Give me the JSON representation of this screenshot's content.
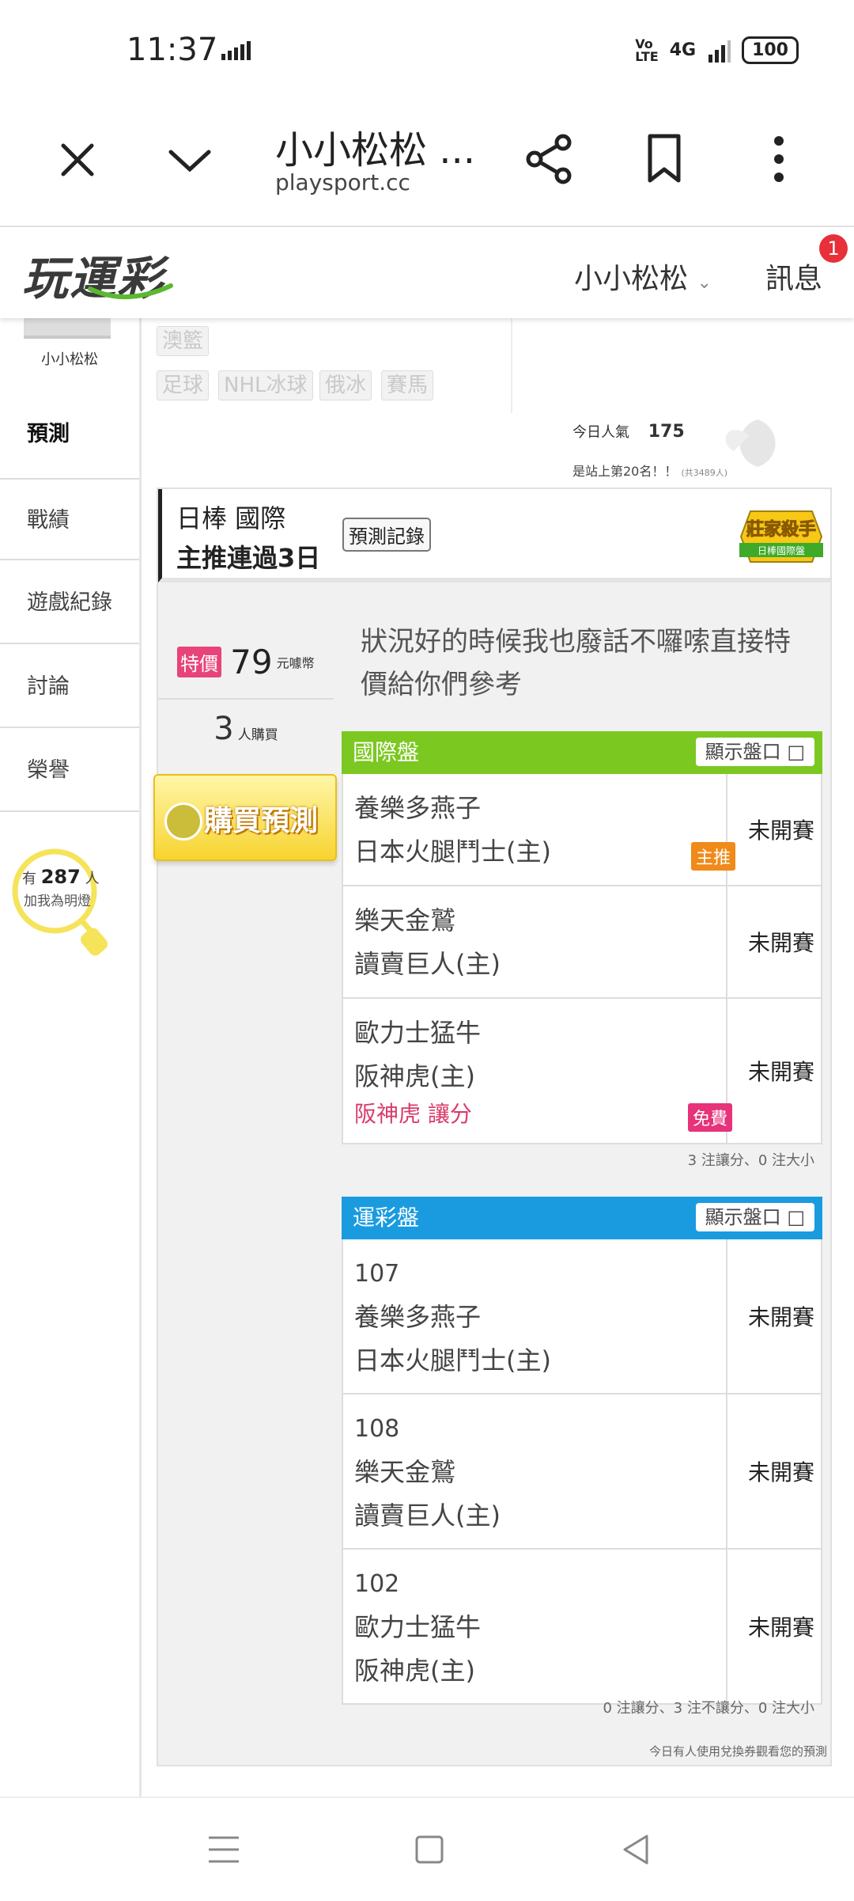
{
  "status_bar": {
    "time": "11:37",
    "network": "4G",
    "volte": "Vo\nLTE",
    "battery": "100"
  },
  "browser": {
    "title": "小小松松 ...",
    "url": "playsport.cc"
  },
  "site": {
    "logo": "玩運彩",
    "user_menu": "小小松松",
    "messages": "訊息",
    "message_badge": "1"
  },
  "sidebar": {
    "username": "小小松松",
    "items": [
      "預測",
      "戰績",
      "遊戲紀錄",
      "討論",
      "榮譽"
    ],
    "fans_prefix": "有",
    "fans_count": "287",
    "fans_suffix": "人",
    "fans_action": "加我為明燈"
  },
  "tags": [
    "澳籃",
    "足球",
    "NHL冰球",
    "俄冰",
    "賽馬"
  ],
  "stats": {
    "popularity_label": "今日人氣",
    "popularity_value": "175",
    "rank_text": "是站上第20名！！",
    "rank_total": "(共3489人)"
  },
  "prediction": {
    "league_line": "日棒 國際",
    "streak_line": "主推連過3日",
    "record_button": "預測記錄",
    "badge_title": "莊家殺手",
    "badge_sub": "日棒國際盤",
    "special_label": "特價",
    "price": "79",
    "price_unit": "元噱幣",
    "buyers_count": "3",
    "buyers_unit": "人購買",
    "buy_button": "購買預測",
    "comment": "狀況好的時候我也廢話不囉嗦直接特價給你們參考"
  },
  "intl_table": {
    "title": "國際盤",
    "show_button": "顯示盤口",
    "color": "#7bc820",
    "rows": [
      {
        "away": "養樂多燕子",
        "home": "日本火腿鬥士(主)",
        "status": "未開賽",
        "mark": "主推"
      },
      {
        "away": "樂天金鷲",
        "home": "讀賣巨人(主)",
        "status": "未開賽"
      },
      {
        "away": "歐力士猛牛",
        "home": "阪神虎(主)",
        "status": "未開賽",
        "pick": "阪神虎 讓分",
        "mark": "免費"
      }
    ],
    "summary": "3 注讓分、0 注大小"
  },
  "lottery_table": {
    "title": "運彩盤",
    "show_button": "顯示盤口",
    "color": "#1a9be0",
    "rows": [
      {
        "num": "107",
        "away": "養樂多燕子",
        "home": "日本火腿鬥士(主)",
        "status": "未開賽"
      },
      {
        "num": "108",
        "away": "樂天金鷲",
        "home": "讀賣巨人(主)",
        "status": "未開賽"
      },
      {
        "num": "102",
        "away": "歐力士猛牛",
        "home": "阪神虎(主)",
        "status": "未開賽"
      }
    ],
    "summary": "0 注讓分、3 注不讓分、0 注大小"
  },
  "bottom_note": "今日有人使用兌換券觀看您的預測"
}
